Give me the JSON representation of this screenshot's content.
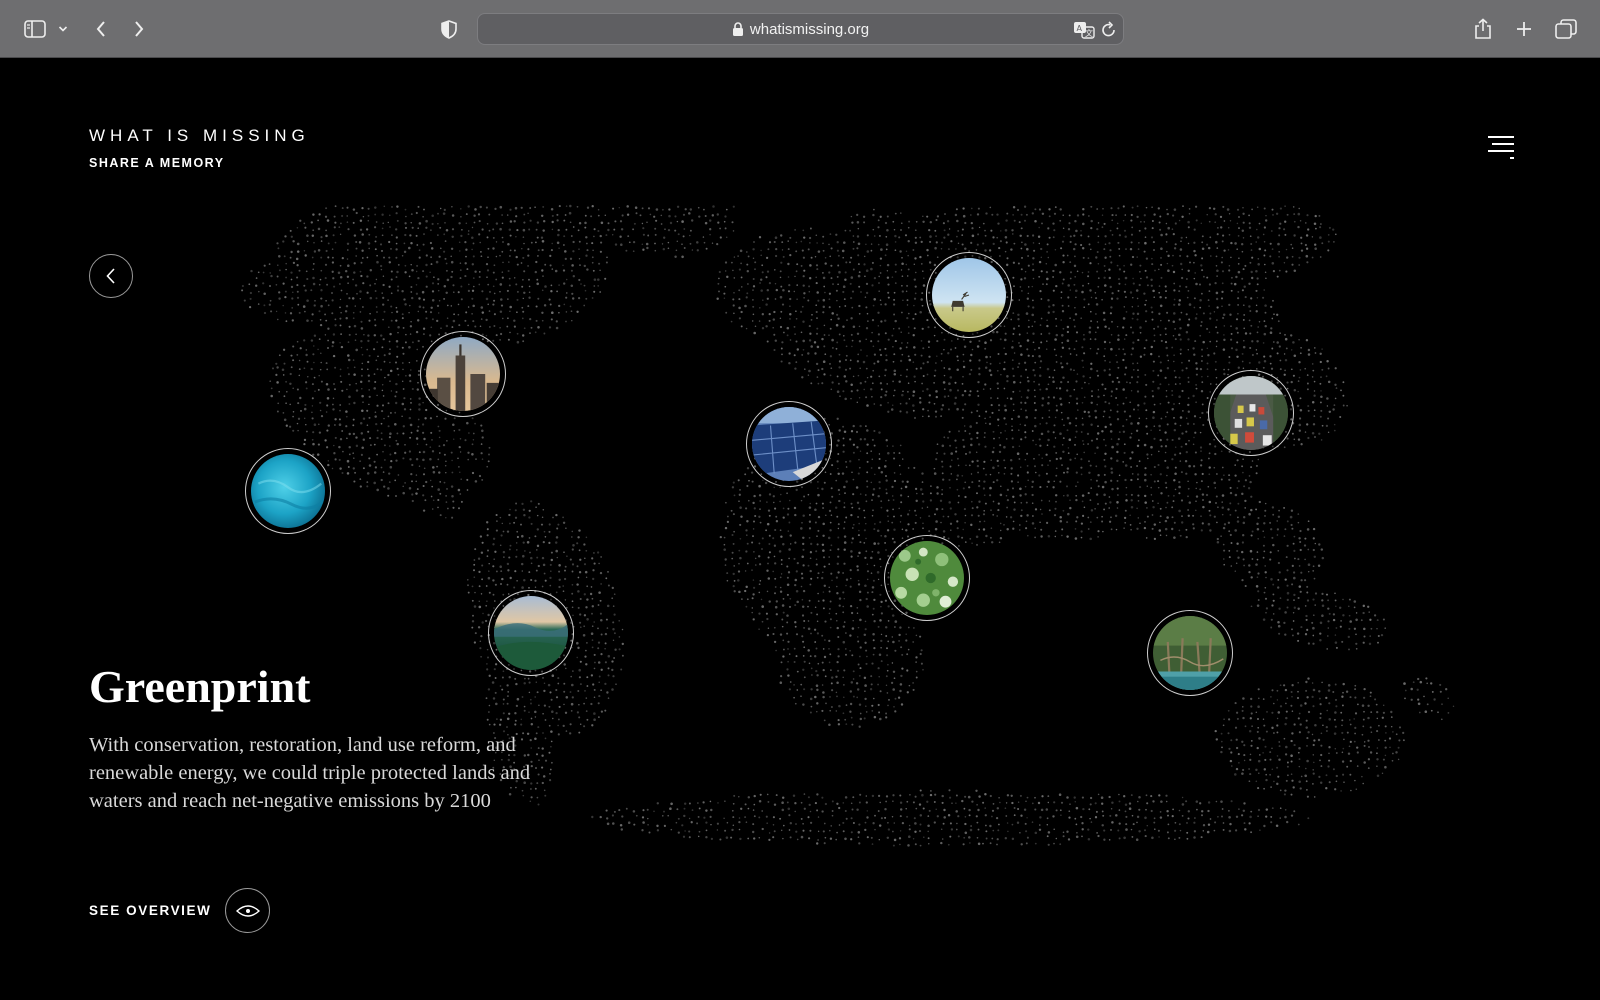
{
  "browser": {
    "url": "whatismissing.org",
    "icons": [
      "sidebar-icon",
      "chevron-down-icon",
      "back-arrow-icon",
      "forward-arrow-icon",
      "shield-icon",
      "lock-icon",
      "translate-icon",
      "reload-icon",
      "share-icon",
      "plus-icon",
      "tabs-icon"
    ]
  },
  "header": {
    "title": "WHAT IS MISSING",
    "subtitle": "SHARE A MEMORY"
  },
  "story": {
    "title": "Greenprint",
    "description": "With conservation, restoration, land use reform, and renewable energy, we could triple protected lands and waters and reach net-negative emissions by 2100",
    "overview_label": "SEE OVERVIEW"
  },
  "markers": [
    {
      "id": "ocean",
      "image": "turquoise-ocean"
    },
    {
      "id": "new-york",
      "image": "city-skyline"
    },
    {
      "id": "amazon",
      "image": "green-valley"
    },
    {
      "id": "europe",
      "image": "solar-panels"
    },
    {
      "id": "russia",
      "image": "reindeer-tundra"
    },
    {
      "id": "china",
      "image": "traffic-highway"
    },
    {
      "id": "india",
      "image": "green-fields-aerial"
    },
    {
      "id": "indonesia",
      "image": "mangrove-forest"
    }
  ],
  "colors": {
    "background": "#000000",
    "chrome": "#6e6e70",
    "text": "#ffffff",
    "map_dots": "#8a8a8a"
  }
}
